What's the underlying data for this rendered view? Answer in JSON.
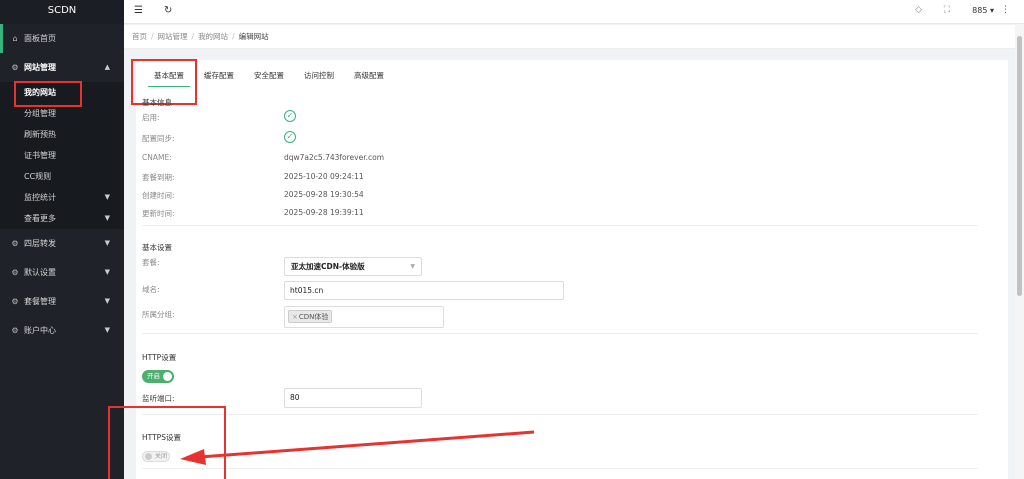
{
  "sidebar": {
    "brand": "SCDN",
    "dashboard": "面板首页",
    "website_mgmt": "网站管理",
    "sub_items": [
      "我的网站",
      "分组管理",
      "刷新预热",
      "证书管理",
      "CC规则",
      "监控统计",
      "查看更多"
    ],
    "l4_forward": "四层转发",
    "default_settings": "默认设置",
    "package_mgmt": "套餐管理",
    "account_center": "账户中心"
  },
  "topbar": {
    "user": "885 ▾"
  },
  "breadcrumb": [
    "首页",
    "网站管理",
    "我的网站",
    "编辑网站"
  ],
  "tabs": [
    "基本配置",
    "缓存配置",
    "安全配置",
    "访问控制",
    "高级配置"
  ],
  "basic_info": {
    "title": "基本信息",
    "enabled_label": "启用:",
    "sync_label": "配置同步:",
    "cname_label": "CNAME:",
    "cname_value": "dqw7a2c5.743forever.com",
    "expire_label": "套餐到期:",
    "expire_value": "2025-10-20 09:24:11",
    "created_label": "创建时间:",
    "created_value": "2025-09-28 19:30:54",
    "updated_label": "更新时间:",
    "updated_value": "2025-09-28 19:39:11"
  },
  "basic_settings": {
    "title": "基本设置",
    "package_label": "套餐:",
    "package_value": "亚太加速CDN-体验版",
    "domain_label": "域名:",
    "domain_value": "ht015.cn",
    "group_label": "所属分组:",
    "group_tag": "CDN体验"
  },
  "http": {
    "title": "HTTP设置",
    "switch": "开启",
    "port_label": "监听端口:",
    "port_value": "80"
  },
  "https": {
    "title": "HTTPS设置",
    "switch": "关闭"
  },
  "colors": {
    "accent": "#36b37e",
    "highlight": "#e8322f",
    "sidebar": "#1f2329"
  }
}
